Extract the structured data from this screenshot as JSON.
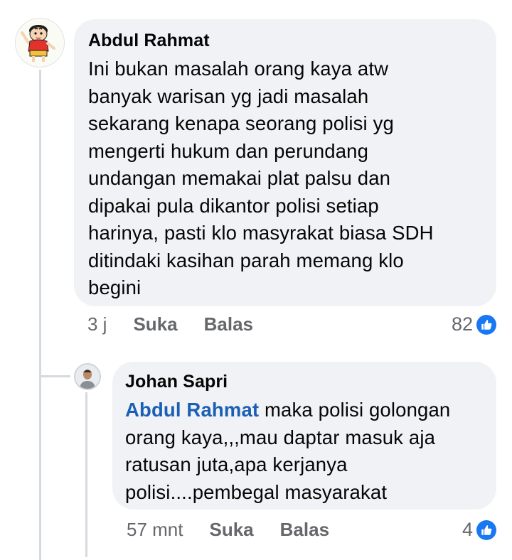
{
  "comments": [
    {
      "author": "Abdul Rahmat",
      "avatar_icon": "cartoon-boy-avatar",
      "text_lines": [
        "Ini bukan masalah orang kaya atw",
        "banyak warisan yg jadi masalah",
        "sekarang kenapa seorang polisi yg",
        "mengerti hukum dan perundang",
        "undangan memakai plat palsu dan",
        "dipakai pula dikantor polisi setiap",
        "harinya, pasti klo masyrakat biasa SDH",
        "ditindaki kasihan parah memang klo",
        "begini"
      ],
      "time": "3 j",
      "like_label": "Suka",
      "reply_label": "Balas",
      "reaction_count": "82",
      "reaction_icon": "like-icon"
    }
  ],
  "reply": {
    "author": "Johan Sapri",
    "avatar_icon": "man-photo-avatar",
    "mention": "Abdul Rahmat",
    "text_first_rest": " maka polisi golongan",
    "text_lines": [
      "orang kaya,,,mau daptar masuk aja",
      "ratusan juta,apa kerjanya",
      "polisi....pembegal masyarakat"
    ],
    "time": "57 mnt",
    "like_label": "Suka",
    "reply_label": "Balas",
    "reaction_count": "4",
    "reaction_icon": "like-icon"
  },
  "colors": {
    "bubble_bg": "#f0f2f5",
    "mention": "#1b5fb5",
    "meta_text": "#65676b",
    "like_blue": "#1877f2",
    "thread_line": "#d6d9dd"
  }
}
